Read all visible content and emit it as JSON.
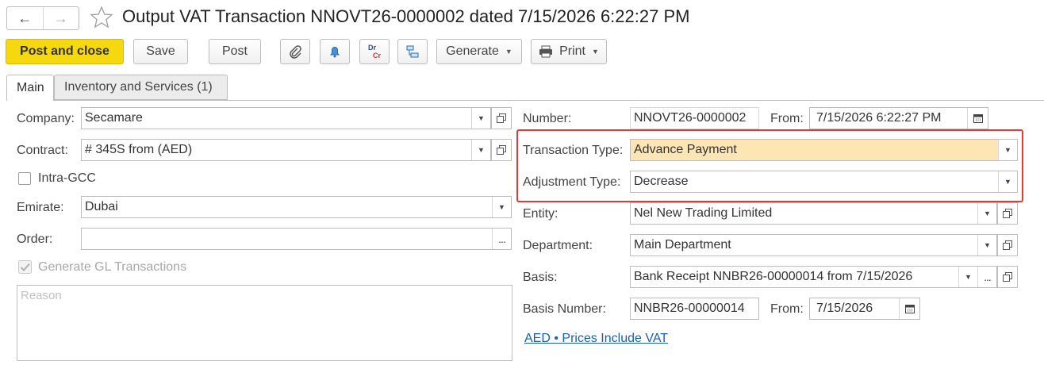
{
  "window": {
    "title": "Output VAT Transaction NNOVT26-0000002 dated 7/15/2026 6:22:27 PM"
  },
  "toolbar": {
    "post_and_close": "Post and close",
    "save": "Save",
    "post": "Post",
    "dr": "Dr",
    "cr": "Cr",
    "generate": "Generate",
    "print": "Print"
  },
  "tabs": [
    {
      "label": "Main"
    },
    {
      "label": "Inventory and Services (1)"
    }
  ],
  "left": {
    "company_label": "Company:",
    "company_value": "Secamare",
    "contract_label": "Contract:",
    "contract_value": "# 345S from  (AED)",
    "intra_gcc_label": "Intra-GCC",
    "emirate_label": "Emirate:",
    "emirate_value": "Dubai",
    "order_label": "Order:",
    "order_value": "",
    "generate_gl_label": "Generate GL Transactions",
    "reason_placeholder": "Reason"
  },
  "right": {
    "number_label": "Number:",
    "number_value": "NNOVT26-0000002",
    "from_label": "From:",
    "from_value": "7/15/2026  6:22:27 PM",
    "transaction_type_label": "Transaction Type:",
    "transaction_type_value": "Advance Payment",
    "adjustment_type_label": "Adjustment Type:",
    "adjustment_type_value": "Decrease",
    "entity_label": "Entity:",
    "entity_value": "Nel New Trading Limited",
    "department_label": "Department:",
    "department_value": "Main Department",
    "basis_label": "Basis:",
    "basis_value": "Bank Receipt NNBR26-00000014 from 7/15/2026",
    "basis_number_label": "Basis Number:",
    "basis_number_value": "NNBR26-00000014",
    "basis_from_label": "From:",
    "basis_from_value": "7/15/2026",
    "currency_link": "AED • Prices Include VAT"
  },
  "colors": {
    "primary_button": "#f5d90e",
    "highlight_field": "#fde6b3",
    "annotation_box": "#e03b3b",
    "link": "#1a5fb4"
  }
}
